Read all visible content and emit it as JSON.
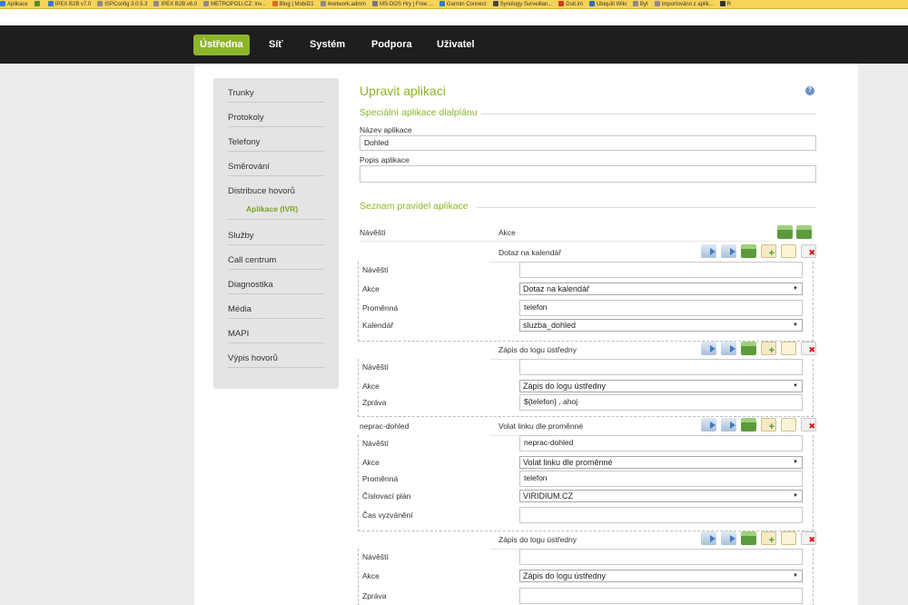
{
  "bookmarks": [
    {
      "label": "Aplikace",
      "color": "#3a79d8"
    },
    {
      "label": "",
      "color": "#4f8d2f"
    },
    {
      "label": "IPEX B2B v7.0",
      "color": "#3a79d8"
    },
    {
      "label": "ISPConfig 3.0.5.3",
      "color": "#8a8a8a"
    },
    {
      "label": "IPEX B2B v6.0",
      "color": "#8a8a8a"
    },
    {
      "label": "METROPOLI.CZ: inv...",
      "color": "#8a8a8a"
    },
    {
      "label": "Blog | Mobil21",
      "color": "#e06b1d"
    },
    {
      "label": "4network.admin",
      "color": "#8a8a8a"
    },
    {
      "label": "MS-DOS Hry | Free ...",
      "color": "#777"
    },
    {
      "label": "Garmin Connect",
      "color": "#2c7fc1"
    },
    {
      "label": "Synology Surveillan...",
      "color": "#444"
    },
    {
      "label": "Doit.im",
      "color": "#d23c2a"
    },
    {
      "label": "Ubiquiti Wiki",
      "color": "#2b6fbf"
    },
    {
      "label": "Byt",
      "color": "#8a8a8a"
    },
    {
      "label": "Importováno z aplik...",
      "color": "#8a8a8a"
    },
    {
      "label": "R",
      "color": "#333"
    }
  ],
  "topnav": {
    "items": [
      {
        "label": "Ústředna"
      },
      {
        "label": "Síť"
      },
      {
        "label": "Systém"
      },
      {
        "label": "Podpora"
      },
      {
        "label": "Uživatel"
      }
    ]
  },
  "sidebar": {
    "items": [
      {
        "label": "Trunky"
      },
      {
        "label": "Protokoly"
      },
      {
        "label": "Telefony"
      },
      {
        "label": "Směrování"
      },
      {
        "label": "Distribuce hovorů"
      },
      {
        "label": "Služby"
      },
      {
        "label": "Call centrum"
      },
      {
        "label": "Diagnostika"
      },
      {
        "label": "Média"
      },
      {
        "label": "MAPI"
      },
      {
        "label": "Výpis hovorů"
      }
    ],
    "sub_active": "Aplikace (IVR)"
  },
  "main": {
    "title": "Upravit aplikaci",
    "help": "?",
    "section_app": "Speciální aplikace dialplánu",
    "name_label": "Název aplikace",
    "name_value": "Dohled",
    "desc_label": "Popis aplikace",
    "desc_value": "",
    "section_rules": "Seznam pravidel aplikace",
    "col_label": "Návěští",
    "col_action": "Akce",
    "rules": [
      {
        "label": "",
        "action": "Dotaz na kalendář",
        "details": [
          {
            "name": "Návěští",
            "value": "",
            "kind": "input"
          },
          {
            "name": "Akce",
            "value": "Dotaz na kalendář",
            "kind": "select"
          },
          {
            "name": "Proměnná",
            "value": "telefon",
            "kind": "input"
          },
          {
            "name": "Kalendář",
            "value": "sluzba_dohled",
            "kind": "select"
          }
        ]
      },
      {
        "label": "",
        "action": "Zápis do logu ústředny",
        "details": [
          {
            "name": "Návěští",
            "value": "",
            "kind": "input"
          },
          {
            "name": "Akce",
            "value": "Zápis do logu ústředny",
            "kind": "select"
          },
          {
            "name": "Zpráva",
            "value": "${telefon} , ahoj",
            "kind": "input"
          }
        ]
      },
      {
        "label": "neprac-dohled",
        "action": "Volat linku dle proměnné",
        "details": [
          {
            "name": "Návěští",
            "value": "neprac-dohled",
            "kind": "input"
          },
          {
            "name": "Akce",
            "value": "Volat linku dle proměnné",
            "kind": "select"
          },
          {
            "name": "Proměnná",
            "value": "telefon",
            "kind": "input"
          },
          {
            "name": "Číslovací plán",
            "value": "VIRIDIUM.CZ",
            "kind": "select"
          },
          {
            "name": "Čas vyzvánění",
            "value": "",
            "kind": "input"
          }
        ]
      },
      {
        "label": "",
        "action": "Zápis do logu ústředny",
        "details": [
          {
            "name": "Návěští",
            "value": "",
            "kind": "input"
          },
          {
            "name": "Akce",
            "value": "Zápis do logu ústředny",
            "kind": "select"
          },
          {
            "name": "Zpráva",
            "value": "",
            "kind": "input"
          }
        ]
      }
    ]
  }
}
